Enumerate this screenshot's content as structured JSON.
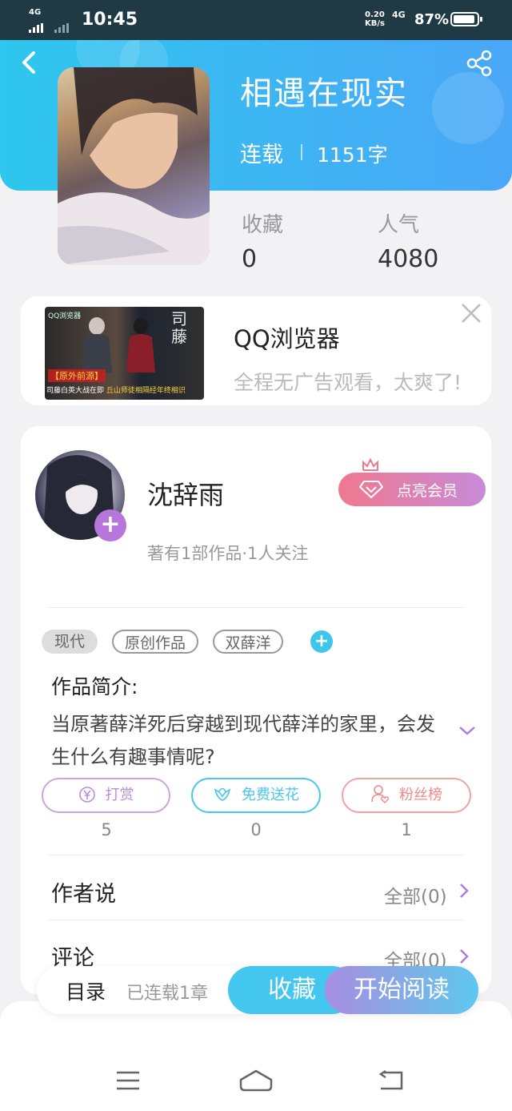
{
  "status_bar": {
    "network_type": "4G",
    "time": "10:45",
    "speed_value": "0.20",
    "speed_unit": "KB/s",
    "net_label": "4G",
    "battery": "87%"
  },
  "book": {
    "title": "相遇在现实",
    "status": "连载",
    "word_count": "1151字",
    "favorites_label": "收藏",
    "favorites_count": "0",
    "popularity_label": "人气",
    "popularity_count": "4080"
  },
  "ad": {
    "title": "QQ浏览器",
    "subtitle": "全程无广告观看，太爽了!",
    "image_caption_tag": "【原外前源】",
    "image_caption": "司藤白英大战在即",
    "image_caption_highlight": "丘山师徒相隔经年终相识",
    "image_brand": "QQ浏览器",
    "image_calligraphy": "司藤"
  },
  "author": {
    "name": "沈辞雨",
    "meta": "著有1部作品·1人关注",
    "vip_button": "点亮会员"
  },
  "tags": [
    "现代",
    "原创作品",
    "双薛洋"
  ],
  "intro": {
    "label": "作品简介:",
    "text": "当原著薛洋死后穿越到现代薛洋的家里，会发生什么有趣事情呢?"
  },
  "actions": [
    {
      "label": "打赏",
      "icon": "yen-icon",
      "count": "5",
      "color": "#b98ddb"
    },
    {
      "label": "免费送花",
      "icon": "flower-icon",
      "count": "0",
      "color": "#4ac6ee"
    },
    {
      "label": "粉丝榜",
      "icon": "fan-icon",
      "count": "1",
      "color": "#f08a8a"
    }
  ],
  "rows": {
    "author_says": {
      "label": "作者说",
      "right": "全部(0)"
    },
    "comments": {
      "label": "评论",
      "right": "全部(0)"
    }
  },
  "bottom_bar": {
    "toc": "目录",
    "chapters": "已连载1章",
    "favorite": "收藏",
    "start_reading": "开始阅读"
  },
  "colors": {
    "header_start": "#2ec7ee",
    "header_end": "#4aa7f7",
    "accent_purple": "#b776d9",
    "accent_blue": "#43c7ef"
  }
}
